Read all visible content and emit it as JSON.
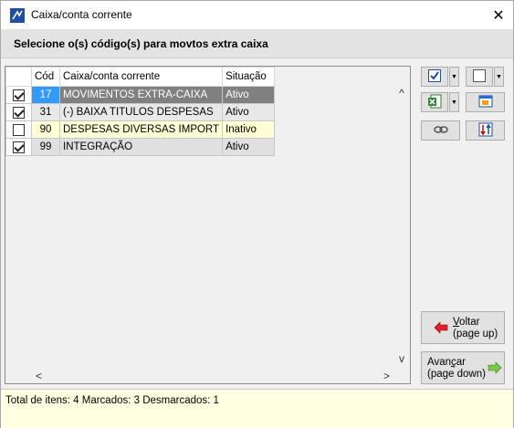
{
  "window": {
    "title": "Caixa/conta corrente",
    "close_glyph": "✕"
  },
  "header": {
    "instruction": "Selecione o(s) código(s) para movtos extra caixa"
  },
  "grid": {
    "columns": [
      "Cód",
      "Caixa/conta corrente",
      "Situação"
    ],
    "rows": [
      {
        "checked": true,
        "cod": "17",
        "desc": "MOVIMENTOS EXTRA-CAIXA",
        "sit": "Ativo",
        "style": "selected"
      },
      {
        "checked": true,
        "cod": "31",
        "desc": "(-) BAIXA TITULOS DESPESAS",
        "sit": "Ativo",
        "style": "white"
      },
      {
        "checked": false,
        "cod": "90",
        "desc": "DESPESAS DIVERSAS IMPORT",
        "sit": "Inativo",
        "style": "yellow"
      },
      {
        "checked": true,
        "cod": "99",
        "desc": "INTEGRAÇÃO",
        "sit": "Ativo",
        "style": "gray"
      }
    ]
  },
  "scroll": {
    "up": "^",
    "down": "v",
    "left": "<",
    "right": ">"
  },
  "toolbar": {
    "icons": [
      "check-all-icon",
      "uncheck-all-icon",
      "excel-export-icon",
      "window-icon",
      "link-icon",
      "sort-icon"
    ],
    "dropdown_glyph": "▼"
  },
  "nav": {
    "back_line1_underline": "V",
    "back_line1_rest": "oltar",
    "back_line2": "(page up)",
    "forward_line1_pre": "Avan",
    "forward_line1_underline": "ç",
    "forward_line1_rest": "ar",
    "forward_line2": "(page down)"
  },
  "status": {
    "text": "Total de itens: 4 Marcados: 3 Desmarcados: 1"
  },
  "colors": {
    "selection_blue": "#3399ff",
    "selection_gray": "#808080",
    "status_bg": "#ffffe1",
    "inactive_row": "#ffffd6"
  }
}
